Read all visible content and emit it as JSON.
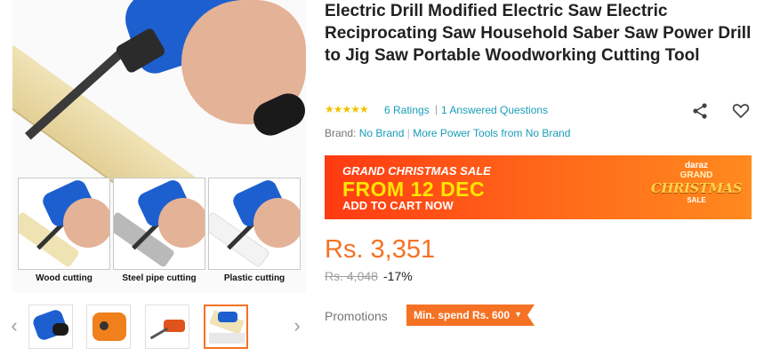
{
  "product": {
    "title": "Electric Drill Modified Electric Saw Electric Reciprocating Saw Household Saber Saw Power Drill to Jig Saw Portable Woodworking Cutting Tool",
    "rating_stars": "★★★★★",
    "ratings_link": "6 Ratings",
    "separator": "|",
    "qa_link": "1 Answered Questions",
    "brand_label": "Brand:",
    "brand_name": "No Brand",
    "more_from": "More Power Tools from No Brand"
  },
  "gallery": {
    "use_cases": [
      {
        "caption": "Wood cutting",
        "material_color": "#efe2b3"
      },
      {
        "caption": "Steel pipe cutting",
        "material_color": "#b9b9b9"
      },
      {
        "caption": "Plastic cutting",
        "material_color": "#f3f3f3"
      }
    ],
    "prev_arrow": "‹",
    "next_arrow": "›",
    "active_thumb_index": 3
  },
  "banner": {
    "line1": "GRAND CHRISTMAS SALE",
    "line2": "FROM 12 DEC",
    "line3": "ADD TO CART NOW",
    "logo_top": "daraz",
    "logo_grand": "GRAND",
    "logo_christmas": "CHRISTMAS",
    "logo_sale": "SALE"
  },
  "pricing": {
    "price": "Rs. 3,351",
    "original_price": "Rs. 4,048",
    "discount": "-17%"
  },
  "promotions": {
    "label": "Promotions",
    "tag": "Min. spend Rs. 600",
    "caret": "▼"
  },
  "colors": {
    "accent_orange": "#f57224",
    "link_teal": "#1a9cb7",
    "star_yellow": "#f2c300"
  }
}
